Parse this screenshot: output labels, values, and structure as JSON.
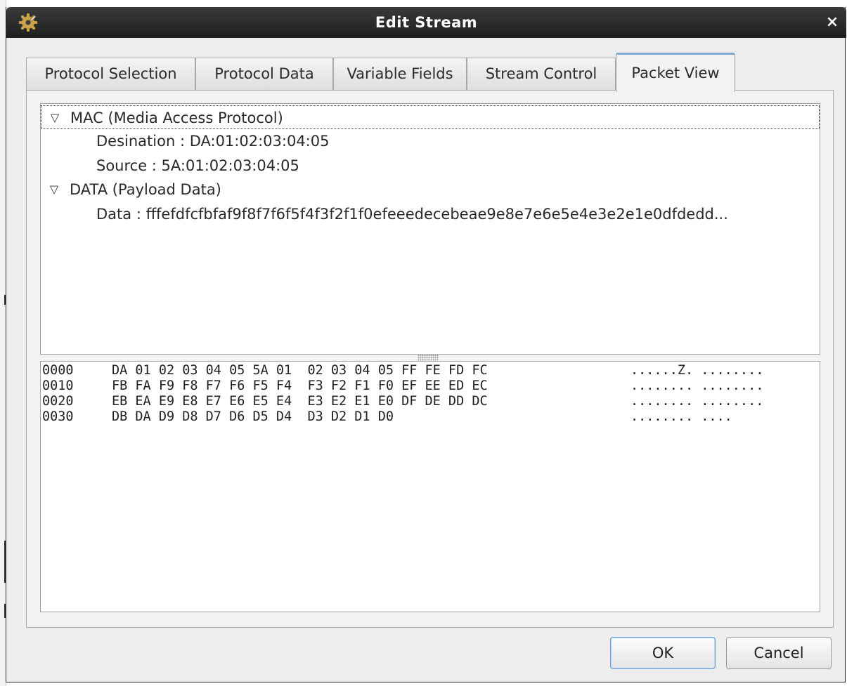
{
  "window": {
    "title": "Edit Stream",
    "icon": "gear-icon",
    "close_glyph": "×"
  },
  "tabs": [
    {
      "label": "Protocol Selection",
      "active": false
    },
    {
      "label": "Protocol Data",
      "active": false
    },
    {
      "label": "Variable Fields",
      "active": false
    },
    {
      "label": "Stream Control",
      "active": false
    },
    {
      "label": "Packet View",
      "active": true
    }
  ],
  "tree": {
    "mac": {
      "label": "MAC (Media Access Protocol)",
      "expanded": true,
      "children": [
        "Desination : DA:01:02:03:04:05",
        "Source : 5A:01:02:03:04:05"
      ]
    },
    "data": {
      "label": "DATA (Payload Data)",
      "expanded": true,
      "children": [
        "Data : fffefdfcfbfaf9f8f7f6f5f4f3f2f1f0efeeedecebeae9e8e7e6e5e4e3e2e1e0dfdedd..."
      ]
    }
  },
  "hex_dump": [
    {
      "offset": "0000",
      "bytes": "DA 01 02 03 04 05 5A 01  02 03 04 05 FF FE FD FC",
      "ascii": "......Z. ........"
    },
    {
      "offset": "0010",
      "bytes": "FB FA F9 F8 F7 F6 F5 F4  F3 F2 F1 F0 EF EE ED EC",
      "ascii": "........ ........"
    },
    {
      "offset": "0020",
      "bytes": "EB EA E9 E8 E7 E6 E5 E4  E3 E2 E1 E0 DF DE DD DC",
      "ascii": "........ ........"
    },
    {
      "offset": "0030",
      "bytes": "DB DA D9 D8 D7 D6 D5 D4  D3 D2 D1 D0",
      "ascii": "........ ...."
    }
  ],
  "buttons": {
    "ok": "OK",
    "cancel": "Cancel"
  },
  "colors": {
    "titlebar": "#2a2a2a",
    "active_tab_accent": "#7fa7d6",
    "default_button_border": "#6e9bd3"
  }
}
